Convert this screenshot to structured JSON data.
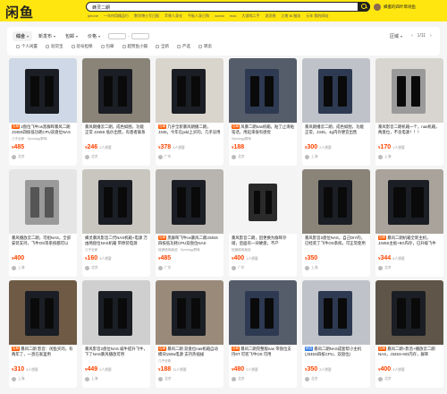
{
  "header": {
    "logo": "闲鱼",
    "search_value": "蜂灵二朗",
    "hot_links": [
      "iphone",
      "一年何用精品行",
      "数学博士写日报",
      "苹果人身化",
      "平板人身已购",
      "xuean",
      "mac",
      "大游戏二手",
      "游灵杨",
      "江南 Bi 服务",
      "元年 我的网站"
    ],
    "user_name": "蜂蜜的四叶草闲鱼"
  },
  "filters": {
    "sort_options": [
      "综合",
      "新发布",
      "包邮",
      "价格"
    ],
    "price_separator": "-",
    "region": "区域",
    "page_indicator": "1/11",
    "checkboxes": [
      "个人闲置",
      "验货宝",
      "验号担保",
      "包邮",
      "超赞鱼小铺",
      "全新",
      "严选",
      "转卖"
    ]
  },
  "products": [
    {
      "title": "2盘位飞牛os黑群晖暴风二朗J345S四核低功耗CPU双盘位NAS",
      "tag": "包邮",
      "tag_color": "orange",
      "sub": "几乎全新 · Synology群晖",
      "price": "485",
      "want": "",
      "seller": "北京",
      "thumb": "blue-white"
    },
    {
      "title": "暴风朗播云二朗，成色如图，功能正常 J345S 低价出售，有意者联系",
      "tag": "",
      "tag_color": "",
      "sub": "",
      "price": "246",
      "want": "2人想要",
      "seller": "北京",
      "thumb": "black-two"
    },
    {
      "title": "几乎全新暴风朗播二朗，J345，今年在pdd上买的，几乎没用过",
      "tag": "包邮",
      "tag_color": "orange",
      "sub": "",
      "price": "378",
      "want": "4人想要",
      "seller": "广东",
      "thumb": "black-bays"
    },
    {
      "title": "风暴二朗nas机箱，贴了止滑贴笔话，用起来很有感觉",
      "tag": "包邮",
      "tag_color": "orange",
      "sub": "Synology群晖",
      "price": "188",
      "want": "",
      "seller": "北京",
      "thumb": "dark-blue"
    },
    {
      "title": "暴风朗播云二朗，成色如图，功能正常，J345，4g内存便宜出售",
      "tag": "",
      "tag_color": "",
      "sub": "",
      "price": "300",
      "want": "2人想要",
      "seller": "上海",
      "thumb": "blue-frame"
    },
    {
      "title": "暴风影音二朗机箱一个，nas机箱，两盘位，不含电源！！！",
      "tag": "",
      "tag_color": "",
      "sub": "",
      "price": "170",
      "want": "1人想要",
      "seller": "上海",
      "thumb": "silver"
    },
    {
      "title": "暴风播放云二朗，可组NAS，全部安装支持，飞牛OS等系统都可以",
      "tag": "",
      "tag_color": "",
      "sub": "",
      "price": "400",
      "want": "",
      "seller": "上海",
      "thumb": "silver-grill"
    },
    {
      "title": "蜂灵暴风影音二代NAS机箱+电源 万由两盘位NAS机箱 带原装电源",
      "tag": "",
      "tag_color": "",
      "sub": "几乎全新",
      "price": "160",
      "want": "3人想要",
      "seller": "北京",
      "thumb": "black-open"
    },
    {
      "title": "黑群晖飞牛os暴风二朗J345S四核低功耗CPU双盘位NAS",
      "tag": "包邮",
      "tag_color": "orange",
      "sub": "轻微使用痕迹 · Synology群晖",
      "price": "485",
      "want": "",
      "seller": "广东",
      "thumb": "black-box"
    },
    {
      "title": "暴风影音二朗，因更换为群晖存储，后面有一块硬盘，不产",
      "tag": "",
      "tag_color": "",
      "sub": "轻微使用痕迹",
      "price": "400",
      "want": "1人想要",
      "seller": "广东",
      "thumb": "screenshot"
    },
    {
      "title": "暴风影音2盘位NAS，自己DIY的，已经装了飞牛OS系统，可正常使用",
      "tag": "",
      "tag_color": "",
      "sub": "",
      "price": "350",
      "want": "",
      "seller": "上海",
      "thumb": "black-two"
    },
    {
      "title": "暴风二朗机箱全新主机，J345S主板+8G内存，已升级飞牛OS",
      "tag": "包邮",
      "tag_color": "orange",
      "sub": "",
      "price": "344",
      "want": "8人想要",
      "seller": "北京",
      "thumb": "black-slanted"
    },
    {
      "title": "暴风二朗 影音：闲鱼买的，有两年了，一直在家里用",
      "tag": "包邮",
      "tag_color": "orange",
      "sub": "",
      "price": "310",
      "want": "3人想要",
      "seller": "上海",
      "thumb": "board"
    },
    {
      "title": "暴风影音2盘位NAS 威牛提升飞牛，下了NAS暴风播放可用",
      "tag": "",
      "tag_color": "",
      "sub": "",
      "price": "449",
      "want": "2人想要",
      "seller": "上海",
      "thumb": "tray"
    },
    {
      "title": "暴风二朗 双盘位nas机箱自动模块150w电源 支持热插拔",
      "tag": "包邮",
      "tag_color": "orange",
      "sub": "几乎全新",
      "price": "188",
      "want": "11人想要",
      "seller": "北京",
      "thumb": "red-tag"
    },
    {
      "title": "暴风二朗完整版nas 带盘位支持8T 可装飞牛OS 可用",
      "tag": "包邮",
      "tag_color": "orange",
      "sub": "",
      "price": "480",
      "want": "2人想要",
      "seller": "北京",
      "thumb": "dark-blue"
    },
    {
      "title": "暴风二朗NAS成套帮小主机(J345S四核CPU，双盘位)",
      "tag": "精选",
      "tag_color": "blue",
      "sub": "",
      "price": "350",
      "want": "3人想要",
      "seller": "北京",
      "thumb": "blue-frame"
    },
    {
      "title": "暴风二朗+影音+播放云二朗 NAS，J345S+8G内存，群晖",
      "tag": "包邮",
      "tag_color": "orange",
      "sub": "",
      "price": "400",
      "want": "3人想要",
      "seller": "北京",
      "thumb": "open-board"
    }
  ]
}
